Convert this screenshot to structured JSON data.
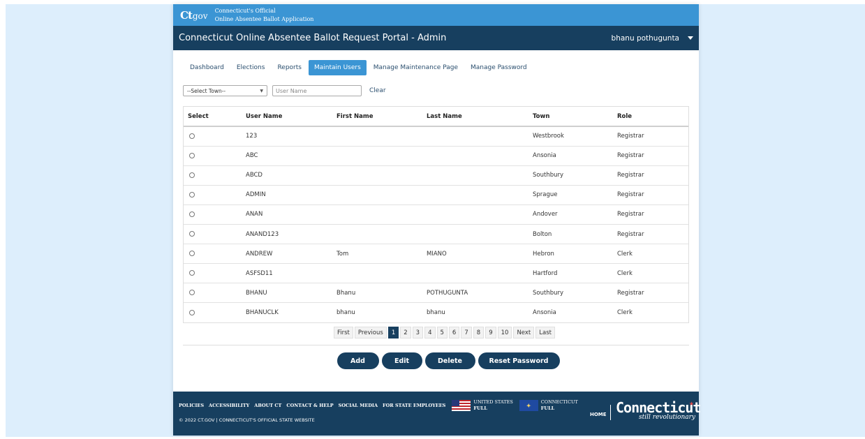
{
  "banner": {
    "logo_ct": "Ct",
    "logo_gov": "gov",
    "line1": "Connecticut's Official",
    "line2": "Online Absentee Ballot Application"
  },
  "header": {
    "title": "Connecticut Online Absentee Ballot Request Portal - Admin",
    "user": "bhanu pothugunta"
  },
  "tabs": [
    {
      "label": "Dashboard",
      "active": false
    },
    {
      "label": "Elections",
      "active": false
    },
    {
      "label": "Reports",
      "active": false
    },
    {
      "label": "Maintain Users",
      "active": true
    },
    {
      "label": "Manage Maintenance Page",
      "active": false
    },
    {
      "label": "Manage Password",
      "active": false
    }
  ],
  "filters": {
    "town_select": "--Select Town--",
    "username_placeholder": "User Name",
    "clear": "Clear"
  },
  "table": {
    "headers": [
      "Select",
      "User Name",
      "First Name",
      "Last Name",
      "Town",
      "Role"
    ],
    "rows": [
      {
        "user": "123",
        "first": "",
        "last": "",
        "town": "Westbrook",
        "role": "Registrar"
      },
      {
        "user": "ABC",
        "first": "",
        "last": "",
        "town": "Ansonia",
        "role": "Registrar"
      },
      {
        "user": "ABCD",
        "first": "",
        "last": "",
        "town": "Southbury",
        "role": "Registrar"
      },
      {
        "user": "ADMIN",
        "first": "",
        "last": "",
        "town": "Sprague",
        "role": "Registrar"
      },
      {
        "user": "ANAN",
        "first": "",
        "last": "",
        "town": "Andover",
        "role": "Registrar"
      },
      {
        "user": "ANAND123",
        "first": "",
        "last": "",
        "town": "Bolton",
        "role": "Registrar"
      },
      {
        "user": "ANDREW",
        "first": "Tom",
        "last": "MIANO",
        "town": "Hebron",
        "role": "Clerk"
      },
      {
        "user": "ASFSD11",
        "first": "",
        "last": "",
        "town": "Hartford",
        "role": "Clerk"
      },
      {
        "user": "BHANU",
        "first": "Bhanu",
        "last": "POTHUGUNTA",
        "town": "Southbury",
        "role": "Registrar"
      },
      {
        "user": "BHANUCLK",
        "first": "bhanu",
        "last": "bhanu",
        "town": "Ansonia",
        "role": "Clerk"
      }
    ]
  },
  "pagination": {
    "items": [
      "First",
      "Previous",
      "1",
      "2",
      "3",
      "4",
      "5",
      "6",
      "7",
      "8",
      "9",
      "10",
      "Next",
      "Last"
    ],
    "current": "1"
  },
  "actions": {
    "add": "Add",
    "edit": "Edit",
    "delete": "Delete",
    "reset_password": "Reset Password"
  },
  "footer": {
    "links": [
      "POLICIES",
      "ACCESSIBILITY",
      "ABOUT CT",
      "CONTACT & HELP",
      "SOCIAL MEDIA",
      "FOR STATE EMPLOYEES"
    ],
    "us_flag_line1": "UNITED STATES",
    "us_flag_line2": "FULL",
    "ct_flag_line1": "CONNECTICUT",
    "ct_flag_line2": "FULL",
    "copyright": "© 2022 CT.GOV | CONNECTICUT'S OFFICIAL STATE WEBSITE",
    "home": "HOME",
    "brand_name": "Connecticut",
    "brand_tag": "still revolutionary"
  },
  "colors": {
    "banner_blue": "#3b95d4",
    "navy": "#173f5f",
    "page_bg": "#ddeefc"
  }
}
